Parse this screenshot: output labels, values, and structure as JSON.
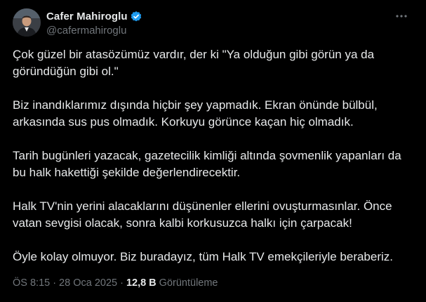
{
  "author": {
    "display_name": "Cafer Mahiroglu",
    "handle": "@cafermahiroglu",
    "verified": true,
    "verified_color": "#1d9bf0",
    "avatar_icon": "profile-photo"
  },
  "more_icon": "more-horizontal-icon",
  "tweet": {
    "paragraphs": [
      "Çok güzel bir atasözümüz vardır, der ki \"Ya olduğun gibi görün ya da göründüğün gibi ol.\"",
      "Biz inandıklarımız dışında hiçbir şey yapmadık. Ekran önünde bülbül, arkasında sus pus olmadık. Korkuyu görünce kaçan hiç olmadık.",
      "Tarih bugünleri yazacak, gazetecilik kimliği altında şovmenlik yapanları da bu halk hakettiği şekilde değerlendirecektir.",
      "Halk TV'nin yerini alacaklarını düşünenler ellerini ovuşturmasınlar. Önce vatan sevgisi olacak, sonra kalbi korkusuzca halkı için çarpacak!",
      "Öyle kolay olmuyor. Biz buradayız, tüm Halk TV emekçileriyle beraberiz."
    ]
  },
  "meta": {
    "time": "ÖS 8:15",
    "separator": "·",
    "date": "28 Oca 2025",
    "views_count": "12,8 B",
    "views_label": "Görüntüleme"
  },
  "colors": {
    "background": "#000000",
    "text_primary": "#e7e9ea",
    "text_secondary": "#71767b"
  }
}
